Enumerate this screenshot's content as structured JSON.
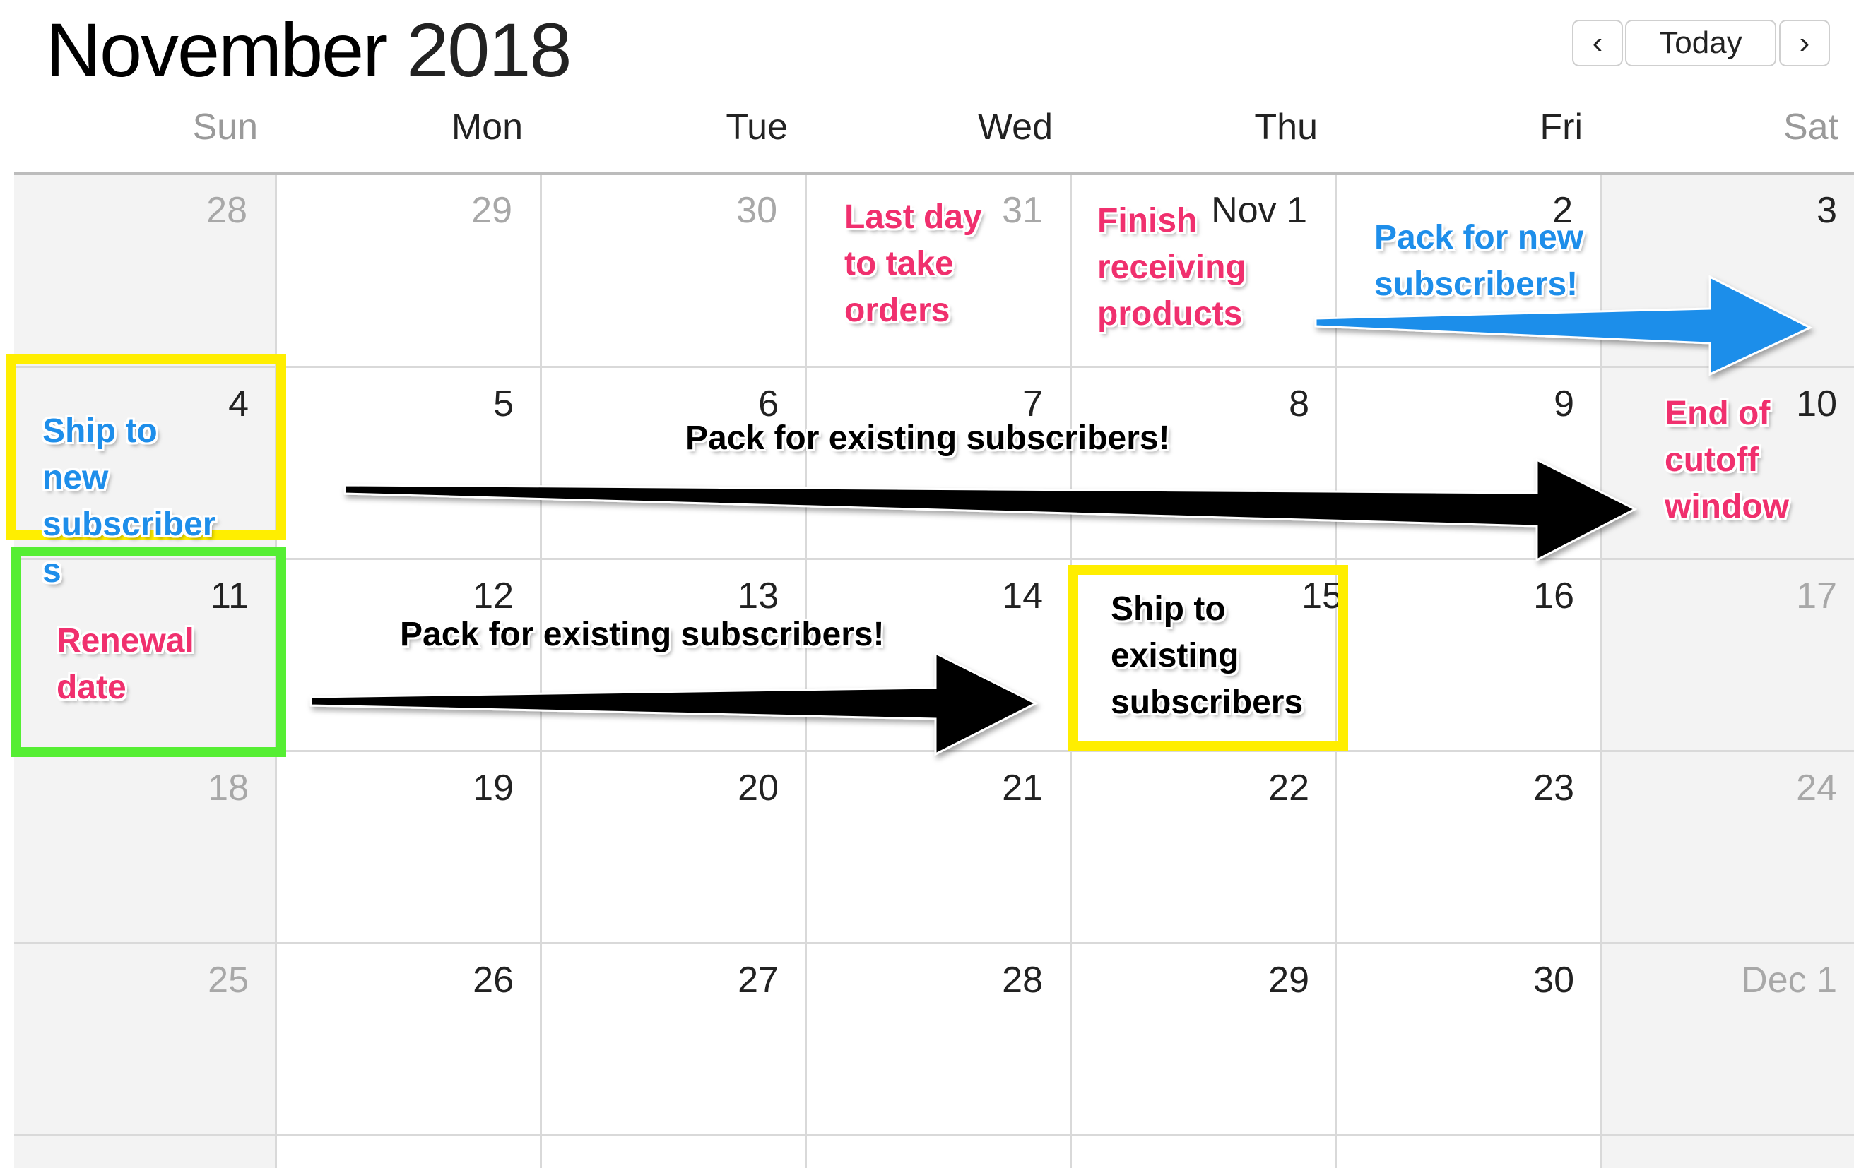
{
  "header": {
    "month": "November",
    "year": "2018",
    "nav": {
      "prev_icon": "‹",
      "today_label": "Today",
      "next_icon": "›"
    }
  },
  "weekdays": [
    "Sun",
    "Mon",
    "Tue",
    "Wed",
    "Thu",
    "Fri",
    "Sat"
  ],
  "weeks": [
    [
      "28",
      "29",
      "30",
      "31",
      "Nov 1",
      "2",
      "3"
    ],
    [
      "4",
      "5",
      "6",
      "7",
      "8",
      "9",
      "10"
    ],
    [
      "11",
      "12",
      "13",
      "14",
      "15",
      "16",
      "17"
    ],
    [
      "18",
      "19",
      "20",
      "21",
      "22",
      "23",
      "24"
    ],
    [
      "25",
      "26",
      "27",
      "28",
      "29",
      "30",
      "Dec 1"
    ]
  ],
  "annotations": {
    "last_day": "Last day\nto take\norders",
    "finish_receiving": "Finish\nreceiving\nproducts",
    "pack_new": "Pack for new\nsubscribers!",
    "ship_new": "Ship to\nnew\nsubscriber\ns",
    "pack_existing_1": "Pack for existing subscribers!",
    "end_cutoff": "End of\ncutoff\nwindow",
    "renewal": "Renewal\ndate",
    "pack_existing_2": "Pack for existing subscribers!",
    "ship_existing": "Ship to\nexisting\nsubscribers"
  },
  "colors": {
    "pink": "#f0306e",
    "blue": "#1e8eea",
    "yellow_box": "#ffee00",
    "green_box": "#55ee33",
    "weekend_bg": "#f3f3f3"
  }
}
